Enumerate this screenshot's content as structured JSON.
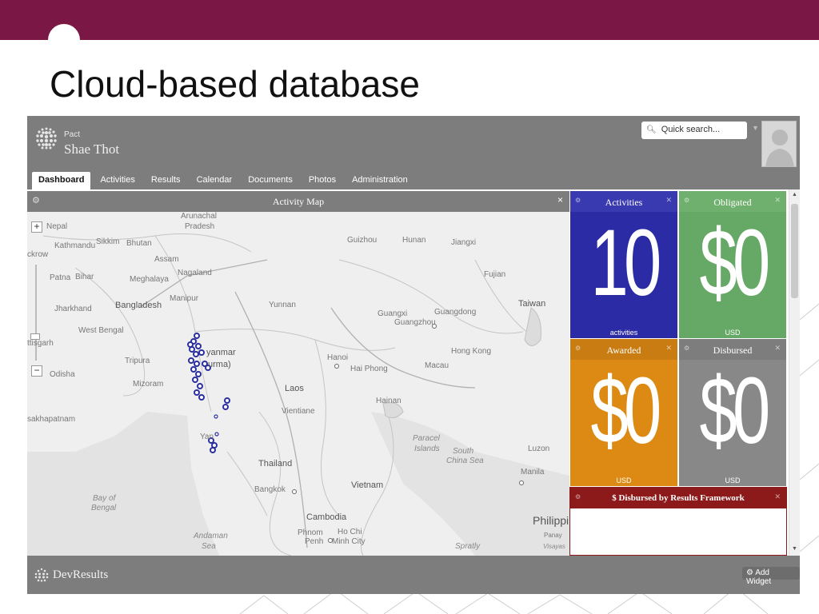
{
  "slide": {
    "title": "Cloud-based database"
  },
  "app": {
    "org_small": "Pact",
    "org_name": "Shae Thot",
    "search_placeholder": "Quick search...",
    "nav": [
      {
        "label": "Dashboard",
        "active": true
      },
      {
        "label": "Activities",
        "active": false
      },
      {
        "label": "Results",
        "active": false
      },
      {
        "label": "Calendar",
        "active": false
      },
      {
        "label": "Documents",
        "active": false
      },
      {
        "label": "Photos",
        "active": false
      },
      {
        "label": "Administration",
        "active": false
      }
    ],
    "map": {
      "title": "Activity Map",
      "zoom_in": "+",
      "zoom_out": "−",
      "labels": {
        "arunachal": "Arunachal",
        "pradesh": "Pradesh",
        "nepal": "Nepal",
        "kathmandu": "Kathmandu",
        "sikkim": "Sikkim",
        "bhutan": "Bhutan",
        "assam": "Assam",
        "nagaland": "Nagaland",
        "patna": "Patna",
        "bihar": "Bihar",
        "meghalaya": "Meghalaya",
        "manipur": "Manipur",
        "jharkhand": "Jharkhand",
        "bangladesh": "Bangladesh",
        "west_bengal": "West Bengal",
        "tripura": "Tripura",
        "mizoram": "Mizoram",
        "odisha": "Odisha",
        "ckrow": "ckrow",
        "ttisgarh": "ttisgarh",
        "sakhapatnam": "sakhapatnam",
        "guizhou": "Guizhou",
        "hunan": "Hunan",
        "jiangxi": "Jiangxi",
        "fujian": "Fujian",
        "yunnan": "Yunnan",
        "guangxi": "Guangxi",
        "guangdong": "Guangdong",
        "guangzhou": "Guangzhou",
        "taiwan": "Taiwan",
        "hong_kong": "Hong Kong",
        "macau": "Macau",
        "hanoi": "Hanoi",
        "hai_phong": "Hai Phong",
        "myanmar": "yanmar",
        "burma": "urma)",
        "laos": "Laos",
        "vientiane": "Vientiane",
        "hainan": "Hainan",
        "paracel": "Paracel",
        "islands": "Islands",
        "south": "South",
        "china_sea": "China Sea",
        "luzon": "Luzon",
        "manila": "Manila",
        "thailand": "Thailand",
        "yangon": "Yan",
        "bangkok": "Bangkok",
        "vietnam": "Vietnam",
        "cambodia": "Cambodia",
        "phnom": "Phnom",
        "penh": "Penh",
        "ho_chi": "Ho Chi",
        "minh_city": "Minh City",
        "bay_of": "Bay of",
        "bengal": "Bengal",
        "andaman": "Andaman",
        "sea": "Sea",
        "spratly": "Spratly",
        "philippi": "Philippir",
        "panay": "Panay",
        "visayas": "Visayas"
      }
    },
    "tiles": [
      {
        "label": "Activities",
        "value": "10",
        "unit": "activities",
        "color": "#2b2ba5"
      },
      {
        "label": "Obligated",
        "value": "$0",
        "unit": "USD",
        "color": "#66a865"
      },
      {
        "label": "Awarded",
        "value": "$0",
        "unit": "USD",
        "color": "#dd8a14"
      },
      {
        "label": "Disbursed",
        "value": "$0",
        "unit": "USD",
        "color": "#888888"
      }
    ],
    "results_widget": {
      "title": "$ Disbursed by Results Framework"
    },
    "footer": {
      "brand": "DevResults",
      "add_widget": "Add Widget"
    },
    "colors": {
      "chrome": "#7d7d7d",
      "slide_band": "#7a1744",
      "results": "#8c1a1a",
      "map_marker": "#2a2fa0"
    }
  }
}
